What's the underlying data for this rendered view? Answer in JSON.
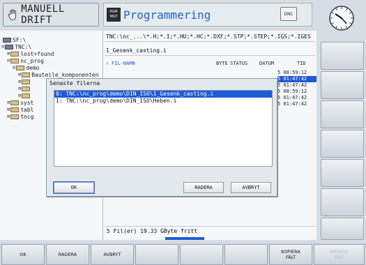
{
  "header": {
    "mode_label": "MANUELL DRIFT",
    "program_badge_line1": "PGM",
    "program_badge_line2": "MGT",
    "program_title": "Programmering",
    "dnc_label": "DNC"
  },
  "tree": {
    "items": [
      {
        "label": "SF:\\",
        "kind": "drive",
        "prefix": ""
      },
      {
        "label": "TNC:\\",
        "kind": "drive",
        "prefix": "⊟"
      },
      {
        "label": "lost+found",
        "kind": "folder",
        "prefix": "⊞"
      },
      {
        "label": "nc_prog",
        "kind": "folder",
        "prefix": "⊟"
      },
      {
        "label": "demo",
        "kind": "folder",
        "prefix": "⊟"
      },
      {
        "label": "Bauteile_komponenten",
        "kind": "folder",
        "prefix": "⊞"
      },
      {
        "label": "",
        "kind": "folder",
        "prefix": "⊞"
      },
      {
        "label": "",
        "kind": "folder",
        "prefix": "⊞"
      },
      {
        "label": "",
        "kind": "folder",
        "prefix": "⊞"
      },
      {
        "label": "syst",
        "kind": "folder",
        "prefix": "⊞"
      },
      {
        "label": "tabl",
        "kind": "folder",
        "prefix": "⊞"
      },
      {
        "label": "tncg",
        "kind": "folder",
        "prefix": "⊞"
      }
    ]
  },
  "filepane": {
    "filter_path": "TNC:\\nc_...\\*.H;*.I;*.HU;*.HC;*.DXF;*.STP;*.STEP;*.IGS;*.IGES",
    "current_file": "1_Gesenk_casting.i",
    "columns": {
      "name": "FIL-NAMN",
      "byte": "BYTE",
      "status": "STATUS",
      "date": "DATUM",
      "time": "TID"
    },
    "time_rows": [
      "5 08:59:12",
      "5 01:47:42",
      "5 01:47:42",
      "5 08:59:12",
      "5 01:47:42",
      "5 01:47:42"
    ],
    "status_text": "5  Fil(er)  19.33 GByte fritt"
  },
  "dialog": {
    "title": "Senaste filerna",
    "items": [
      "0: TNC:\\nc_prog\\demo\\DIN_ISO\\1_Gesenk_casting.i",
      "1: TNC:\\nc_prog\\demo\\DIN_ISO\\Heben.i"
    ],
    "ok_label": "OK",
    "delete_label": "RADERA",
    "cancel_label": "AVBRYT"
  },
  "softkeys": {
    "bottom": [
      {
        "label": "OK",
        "enabled": true
      },
      {
        "label": "RADERA",
        "enabled": true
      },
      {
        "label": "AVBRYT",
        "enabled": true
      },
      {
        "label": "",
        "enabled": true
      },
      {
        "label": "",
        "enabled": true
      },
      {
        "label": "",
        "enabled": true
      },
      {
        "label": "KOPIERA\nFÄLT",
        "enabled": true
      },
      {
        "label": "INFOGA\nFÄLT",
        "enabled": false
      }
    ]
  },
  "colors": {
    "accent": "#1f5bd6",
    "title_blue": "#2063c9",
    "background": "#d7dde4"
  }
}
